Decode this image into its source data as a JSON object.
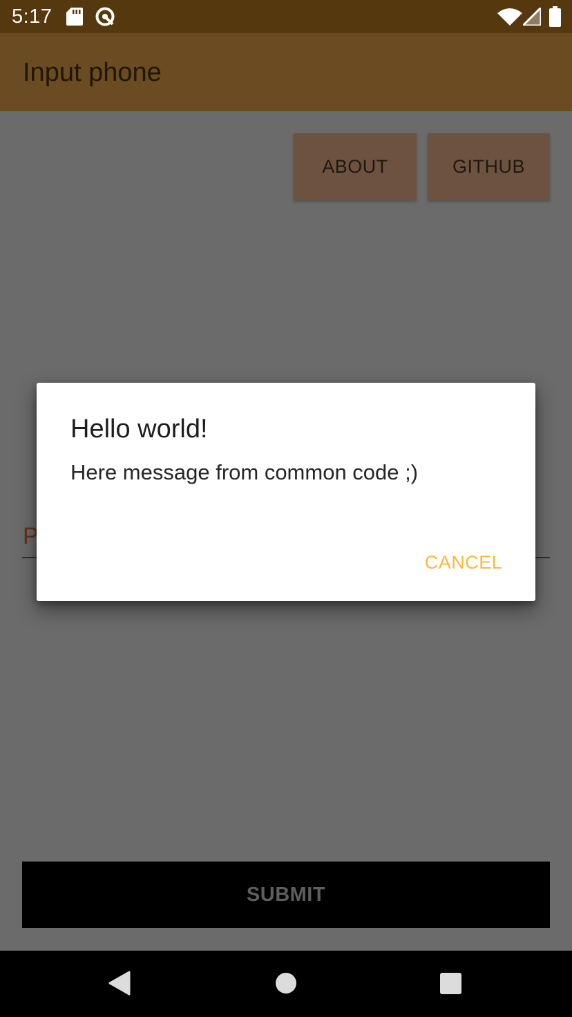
{
  "status_bar": {
    "time": "5:17",
    "left_icons": [
      "sd-card-icon",
      "data-saver-icon"
    ],
    "right_icons": [
      "wifi-icon",
      "cell-signal-icon",
      "battery-icon"
    ]
  },
  "app_bar": {
    "title": "Input phone",
    "color": "#6a4b22"
  },
  "main": {
    "about_label": "ABOUT",
    "github_label": "GITHUB",
    "phone_hint": "P",
    "submit_label": "SUBMIT"
  },
  "dialog": {
    "title": "Hello world!",
    "message": "Here message from common code ;)",
    "cancel_label": "CANCEL",
    "accent_color": "#f9b93a"
  },
  "nav_bar": {
    "icons": [
      "back-icon",
      "home-icon",
      "recents-icon"
    ]
  }
}
